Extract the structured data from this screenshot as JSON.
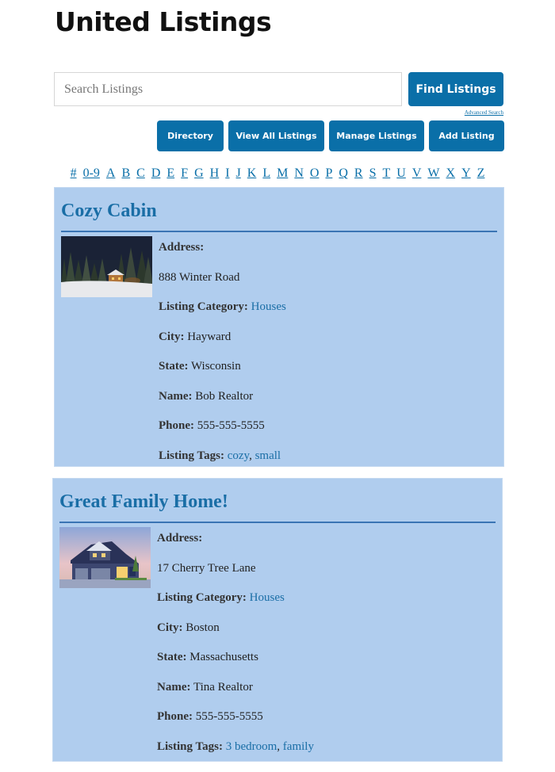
{
  "site": {
    "title": "United Listings"
  },
  "search": {
    "placeholder": "Search Listings",
    "value": "",
    "find_label": "Find Listings",
    "advanced_label": "Advanced Search"
  },
  "nav": {
    "buttons": [
      {
        "label": "Directory"
      },
      {
        "label": "View All Listings"
      },
      {
        "label": "Manage Listings"
      },
      {
        "label": "Add Listing"
      }
    ]
  },
  "alphabet": [
    "#",
    "0-9",
    "A",
    "B",
    "C",
    "D",
    "E",
    "F",
    "G",
    "H",
    "I",
    "J",
    "K",
    "L",
    "M",
    "N",
    "O",
    "P",
    "Q",
    "R",
    "S",
    "T",
    "U",
    "V",
    "W",
    "X",
    "Y",
    "Z"
  ],
  "colors": {
    "accent": "#0a6fa8",
    "listing_bg": "#b0cdee",
    "link": "#1a6ea6"
  },
  "listings": [
    {
      "title": "Cozy Cabin",
      "image": "snowy-cabin-at-night",
      "address_label": "Address:",
      "address": "888 Winter Road",
      "category_label": "Listing Category:",
      "category": "Houses",
      "city_label": "City:",
      "city": "Hayward",
      "state_label": "State:",
      "state": "Wisconsin",
      "name_label": "Name:",
      "name": "Bob Realtor",
      "phone_label": "Phone:",
      "phone": "555-555-5555",
      "tags_label": "Listing Tags:",
      "tags": [
        "cozy",
        "small"
      ]
    },
    {
      "title": "Great Family Home!",
      "image": "suburban-house-at-dusk",
      "address_label": "Address:",
      "address": "17 Cherry Tree Lane",
      "category_label": "Listing Category:",
      "category": "Houses",
      "city_label": "City:",
      "city": "Boston",
      "state_label": "State:",
      "state": "Massachusetts",
      "name_label": "Name:",
      "name": "Tina Realtor",
      "phone_label": "Phone:",
      "phone": "555-555-5555",
      "tags_label": "Listing Tags:",
      "tags": [
        "3 bedroom",
        "family"
      ]
    }
  ]
}
